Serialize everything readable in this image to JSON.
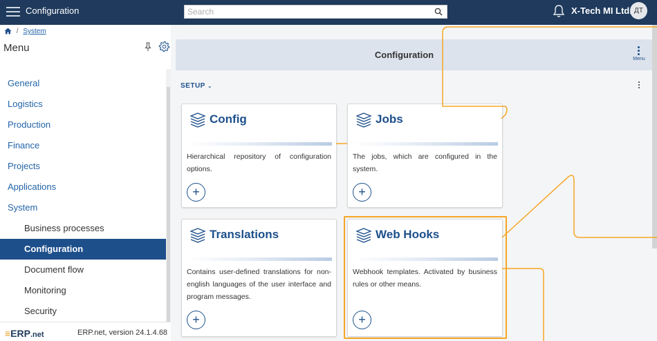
{
  "topbar": {
    "title": "Configuration",
    "search_placeholder": "Search",
    "company": "X-Tech MI Ltd.",
    "avatar_initials": "ДТ"
  },
  "breadcrumb": {
    "separator": "/",
    "current": "System"
  },
  "sidebar": {
    "title": "Menu",
    "items": [
      {
        "label": "General",
        "level": 1,
        "active": false
      },
      {
        "label": "Logistics",
        "level": 1,
        "active": false
      },
      {
        "label": "Production",
        "level": 1,
        "active": false
      },
      {
        "label": "Finance",
        "level": 1,
        "active": false
      },
      {
        "label": "Projects",
        "level": 1,
        "active": false
      },
      {
        "label": "Applications",
        "level": 1,
        "active": false
      },
      {
        "label": "System",
        "level": 1,
        "active": false
      },
      {
        "label": "Business processes",
        "level": 2,
        "active": false
      },
      {
        "label": "Configuration",
        "level": 2,
        "active": true
      },
      {
        "label": "Document flow",
        "level": 2,
        "active": false
      },
      {
        "label": "Monitoring",
        "level": 2,
        "active": false
      },
      {
        "label": "Security",
        "level": 2,
        "active": false
      }
    ],
    "logo_mark": "≡",
    "logo_text": "ERP",
    "logo_suffix": ".net",
    "version": "ERP.net, version 24.1.4.68"
  },
  "main": {
    "header_title": "Configuration",
    "menu_label": "Menu",
    "section_label": "SETUP",
    "add_symbol": "+",
    "cards": [
      {
        "title": "Config",
        "description": "Hierarchical repository of configuration options."
      },
      {
        "title": "Jobs",
        "description": "The jobs, which are configured in the system."
      },
      {
        "title": "Translations",
        "description": "Contains user-defined translations for non-english languages of the user interface and program messages."
      },
      {
        "title": "Web Hooks",
        "description": "Webhook templates. Activated by business rules or other means."
      }
    ]
  },
  "colors": {
    "topbar": "#1f3a5c",
    "accent": "#1d4f8b",
    "link": "#2264a8",
    "highlight": "#f5a623"
  }
}
